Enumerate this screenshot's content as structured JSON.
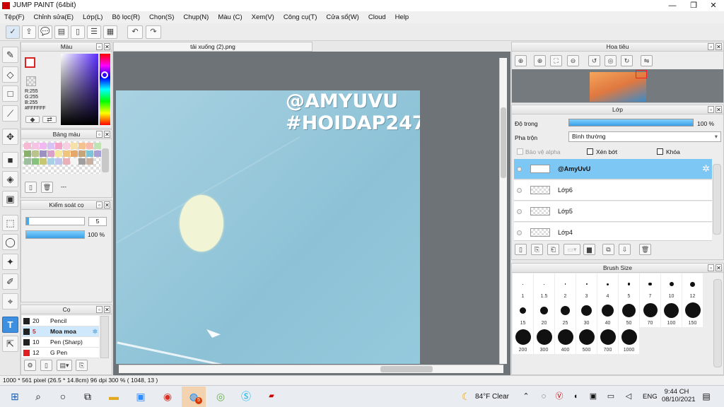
{
  "window": {
    "title": "JUMP PAINT (64bit)",
    "min": "—",
    "max": "❐",
    "close": "✕"
  },
  "menu": [
    "Tệp(F)",
    "Chỉnh sửa(E)",
    "Lớp(L)",
    "Bộ lọc(R)",
    "Chọn(S)",
    "Chụp(N)",
    "Màu (C)",
    "Xem(V)",
    "Công cụ(T)",
    "Cửa sổ(W)",
    "Cloud",
    "Help"
  ],
  "toolbar_icons": [
    "check-icon",
    "export-icon",
    "comment-icon",
    "message-icon",
    "document-icon",
    "list-icon",
    "grid-icon",
    "undo-icon",
    "redo-icon"
  ],
  "color_panel": {
    "title": "Màu",
    "r": "R:255",
    "g": "G:255",
    "b": "B:255",
    "hex": "#FFFFFF"
  },
  "palette_panel": {
    "title": "Bảng màu",
    "dash": "---"
  },
  "brush_control": {
    "title": "Kiểm soát cọ",
    "size": "5",
    "opacity": "100 %",
    "size_fraction": 0.05,
    "opacity_fraction": 1.0
  },
  "brushes": {
    "title": "Cọ",
    "items": [
      {
        "n": "20",
        "name": "Pencil",
        "color": "#222222"
      },
      {
        "n": "5",
        "name": "Moa moa",
        "color": "#222222"
      },
      {
        "n": "10",
        "name": "Pen (Sharp)",
        "color": "#222222"
      },
      {
        "n": "12",
        "name": "G Pen",
        "color": "#e02020"
      }
    ]
  },
  "document": {
    "tab": "tải xuống (2).png",
    "watermark_1": "@AMYUVU",
    "watermark_2": "#HOIDAP247"
  },
  "navigator": {
    "title": "Hoa tiêu"
  },
  "layers": {
    "title": "Lớp",
    "opacity_label": "Độ trong",
    "opacity_value": "100 %",
    "blend_label": "Pha trộn",
    "blend_value": "Bình thường",
    "protect_alpha": "Bảo vệ alpha",
    "clip": "Xén bớt",
    "lock": "Khóa",
    "items": [
      "@AmyUvU",
      "Lớp6",
      "Lớp5",
      "Lớp4"
    ]
  },
  "brush_size": {
    "title": "Brush Size",
    "sizes": [
      "1",
      "1.5",
      "2",
      "3",
      "4",
      "5",
      "7",
      "10",
      "12",
      "15",
      "20",
      "25",
      "30",
      "40",
      "50",
      "70",
      "100",
      "150",
      "200",
      "300",
      "400",
      "500",
      "700",
      "1000"
    ]
  },
  "status": {
    "text": "1000 * 561 pixel   (26.5 * 14.8cm)   96 dpi   300 %   ( 1048, 13 )"
  },
  "taskbar": {
    "weather": "84°F  Clear",
    "lang": "ENG",
    "time": "9:44 CH",
    "date": "08/10/2021",
    "badge": "5"
  }
}
